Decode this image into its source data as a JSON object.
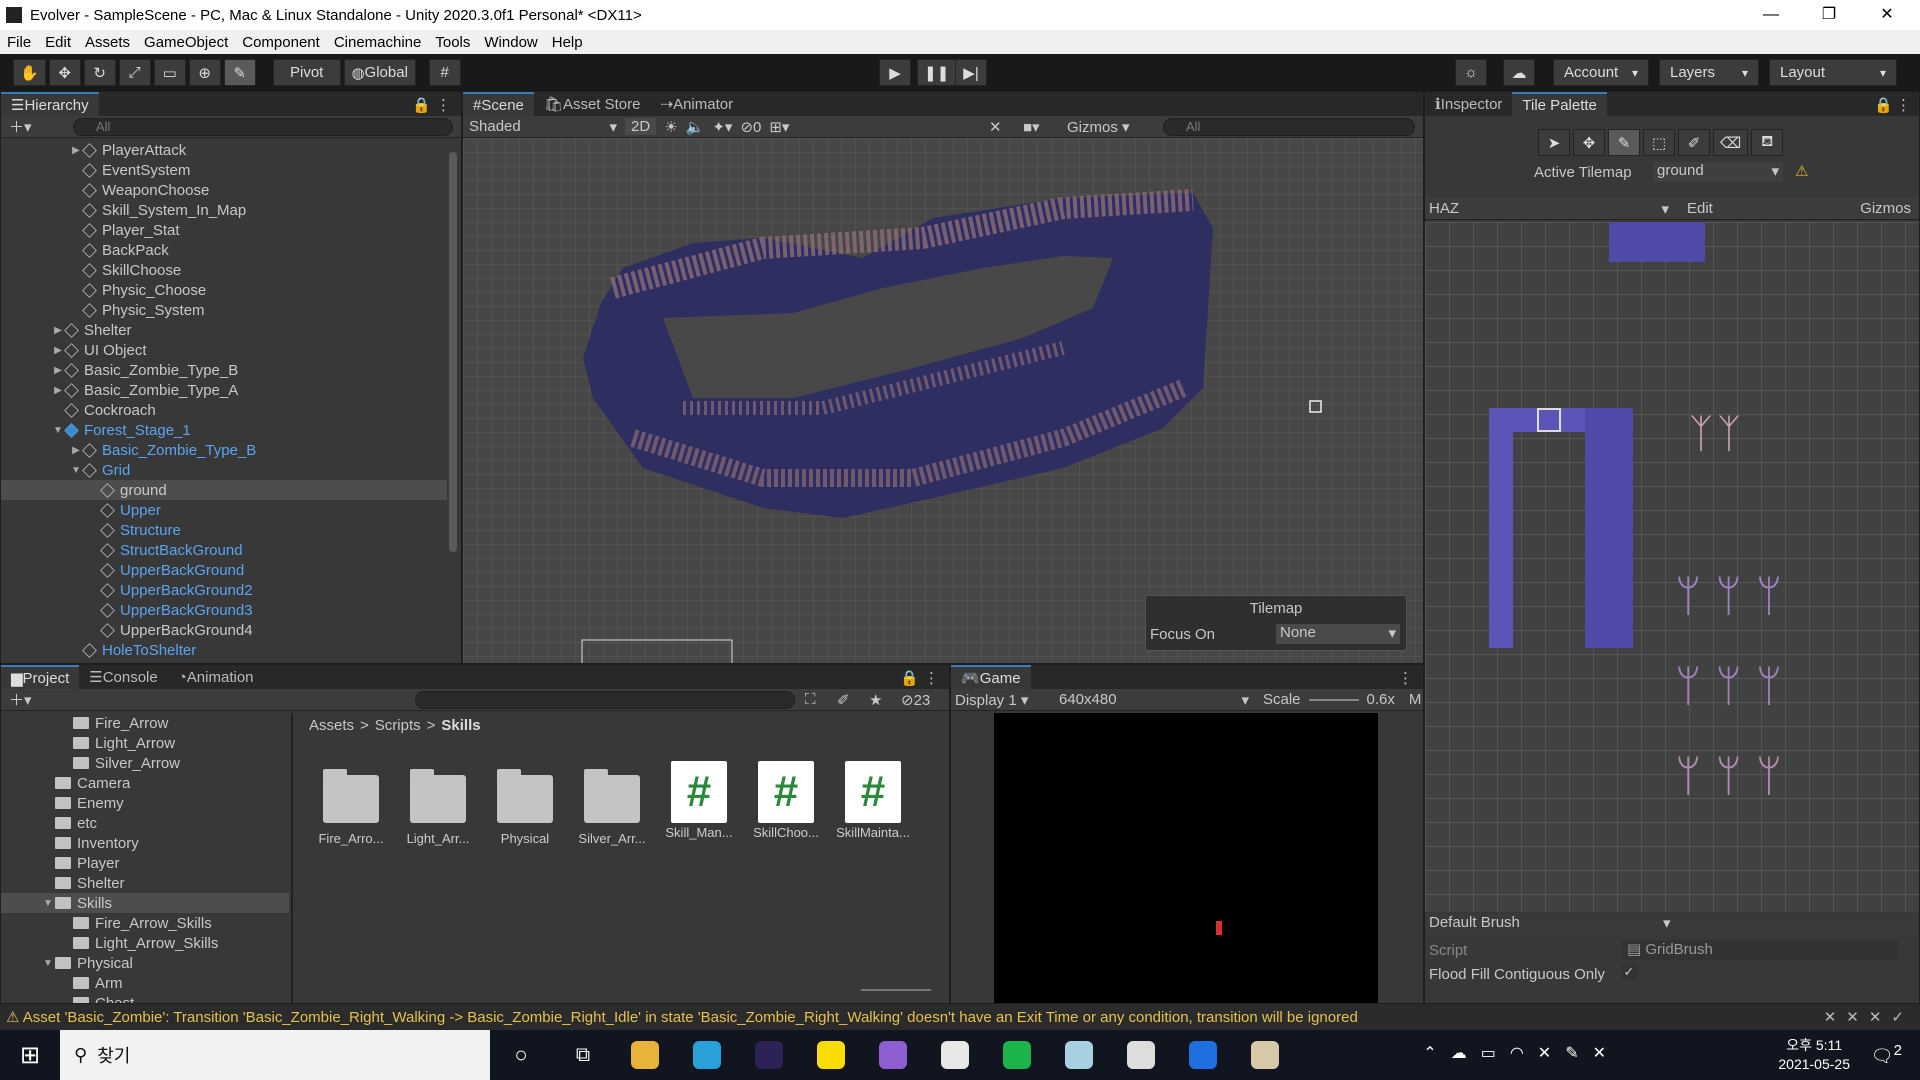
{
  "window": {
    "title": "Evolver - SampleScene - PC, Mac & Linux Standalone - Unity 2020.3.0f1 Personal* <DX11>",
    "min": "—",
    "max": "❐",
    "close": "✕"
  },
  "menu": [
    "File",
    "Edit",
    "Assets",
    "GameObject",
    "Component",
    "Cinemachine",
    "Tools",
    "Window",
    "Help"
  ],
  "toolbar": {
    "pivot": "Pivot",
    "global": "Global",
    "account": "Account",
    "layers": "Layers",
    "layout": "Layout"
  },
  "hierarchy": {
    "tab": "Hierarchy",
    "search_placeholder": "All",
    "rows": [
      {
        "label": "PlayerAttack",
        "depth": 2,
        "arrow": "▶",
        "blue": false
      },
      {
        "label": "EventSystem",
        "depth": 2,
        "arrow": "",
        "blue": false
      },
      {
        "label": "WeaponChoose",
        "depth": 2,
        "arrow": "",
        "blue": false
      },
      {
        "label": "Skill_System_In_Map",
        "depth": 2,
        "arrow": "",
        "blue": false
      },
      {
        "label": "Player_Stat",
        "depth": 2,
        "arrow": "",
        "blue": false
      },
      {
        "label": "BackPack",
        "depth": 2,
        "arrow": "",
        "blue": false
      },
      {
        "label": "SkillChoose",
        "depth": 2,
        "arrow": "",
        "blue": false
      },
      {
        "label": "Physic_Choose",
        "depth": 2,
        "arrow": "",
        "blue": false
      },
      {
        "label": "Physic_System",
        "depth": 2,
        "arrow": "",
        "blue": false
      },
      {
        "label": "Shelter",
        "depth": 1,
        "arrow": "▶",
        "blue": false
      },
      {
        "label": "UI Object",
        "depth": 1,
        "arrow": "▶",
        "blue": false
      },
      {
        "label": "Basic_Zombie_Type_B",
        "depth": 1,
        "arrow": "▶",
        "blue": false
      },
      {
        "label": "Basic_Zombie_Type_A",
        "depth": 1,
        "arrow": "▶",
        "blue": false
      },
      {
        "label": "Cockroach",
        "depth": 1,
        "arrow": "",
        "blue": false
      },
      {
        "label": "Forest_Stage_1",
        "depth": 1,
        "arrow": "▼",
        "blue": true
      },
      {
        "label": "Basic_Zombie_Type_B",
        "depth": 2,
        "arrow": "▶",
        "blue": true
      },
      {
        "label": "Grid",
        "depth": 2,
        "arrow": "▼",
        "blue": true
      },
      {
        "label": "ground",
        "depth": 3,
        "arrow": "",
        "blue": false,
        "selected": true
      },
      {
        "label": "Upper",
        "depth": 3,
        "arrow": "",
        "blue": true
      },
      {
        "label": "Structure",
        "depth": 3,
        "arrow": "",
        "blue": true
      },
      {
        "label": "StructBackGround",
        "depth": 3,
        "arrow": "",
        "blue": true
      },
      {
        "label": "UpperBackGround",
        "depth": 3,
        "arrow": "",
        "blue": true
      },
      {
        "label": "UpperBackGround2",
        "depth": 3,
        "arrow": "",
        "blue": true
      },
      {
        "label": "UpperBackGround3",
        "depth": 3,
        "arrow": "",
        "blue": true
      },
      {
        "label": "UpperBackGround4",
        "depth": 3,
        "arrow": "",
        "blue": false
      },
      {
        "label": "HoleToShelter",
        "depth": 2,
        "arrow": "",
        "blue": true
      }
    ]
  },
  "scene": {
    "tabs": [
      "Scene",
      "Asset Store",
      "Animator"
    ],
    "shading": "Shaded",
    "mode2d": "2D",
    "hidden_count": "0",
    "gizmos": "Gizmos",
    "search_placeholder": "All",
    "overlay": {
      "title": "Tilemap",
      "focus_label": "Focus On",
      "focus_value": "None"
    }
  },
  "inspector": {
    "tabs": [
      "Inspector",
      "Tile Palette"
    ],
    "active_tilemap_label": "Active Tilemap",
    "active_tilemap_value": "ground",
    "palette": "HAZ",
    "edit": "Edit",
    "gizmos": "Gizmos",
    "brush": "Default Brush",
    "script_label": "Script",
    "script_value": "GridBrush",
    "flood_label": "Flood Fill Contiguous Only",
    "flood_check": "✓"
  },
  "project": {
    "tabs": [
      "Project",
      "Console",
      "Animation"
    ],
    "hidden_count": "23",
    "tree": [
      {
        "label": "Fire_Arrow",
        "depth": 2,
        "arrow": ""
      },
      {
        "label": "Light_Arrow",
        "depth": 2,
        "arrow": ""
      },
      {
        "label": "Silver_Arrow",
        "depth": 2,
        "arrow": ""
      },
      {
        "label": "Camera",
        "depth": 1,
        "arrow": ""
      },
      {
        "label": "Enemy",
        "depth": 1,
        "arrow": ""
      },
      {
        "label": "etc",
        "depth": 1,
        "arrow": ""
      },
      {
        "label": "Inventory",
        "depth": 1,
        "arrow": ""
      },
      {
        "label": "Player",
        "depth": 1,
        "arrow": ""
      },
      {
        "label": "Shelter",
        "depth": 1,
        "arrow": ""
      },
      {
        "label": "Skills",
        "depth": 1,
        "arrow": "▼",
        "selected": true
      },
      {
        "label": "Fire_Arrow_Skills",
        "depth": 2,
        "arrow": ""
      },
      {
        "label": "Light_Arrow_Skills",
        "depth": 2,
        "arrow": ""
      },
      {
        "label": "Physical",
        "depth": 1,
        "arrow": "▼"
      },
      {
        "label": "Arm",
        "depth": 2,
        "arrow": ""
      },
      {
        "label": "Chest",
        "depth": 2,
        "arrow": ""
      }
    ],
    "breadcrumb": [
      "Assets",
      "Scripts",
      "Skills"
    ],
    "assets": [
      {
        "label": "Fire_Arro...",
        "type": "folder"
      },
      {
        "label": "Light_Arr...",
        "type": "folder"
      },
      {
        "label": "Physical",
        "type": "folder"
      },
      {
        "label": "Silver_Arr...",
        "type": "folder"
      },
      {
        "label": "Skill_Man...",
        "type": "script"
      },
      {
        "label": "SkillChoo...",
        "type": "script"
      },
      {
        "label": "SkillMainta...",
        "type": "script"
      }
    ]
  },
  "game": {
    "tab": "Game",
    "display": "Display 1",
    "resolution": "640x480",
    "scale_label": "Scale",
    "scale_value": "0.6x",
    "more": "M"
  },
  "status": "⚠ Asset 'Basic_Zombie': Transition 'Basic_Zombie_Right_Walking -> Basic_Zombie_Right_Idle' in state 'Basic_Zombie_Right_Walking' doesn't have an Exit Time or any condition, transition will be ignored",
  "taskbar": {
    "search": "찾기",
    "time": "오후 5:11",
    "date": "2021-05-25",
    "notif": "2",
    "apps": [
      {
        "name": "file-explorer-icon",
        "color": "#e8b339"
      },
      {
        "name": "edge-icon",
        "color": "#2aa0d8"
      },
      {
        "name": "eclipse-icon",
        "color": "#2c2255"
      },
      {
        "name": "kakaotalk-icon",
        "color": "#f8de00"
      },
      {
        "name": "visual-studio-icon",
        "color": "#8e5fd0"
      },
      {
        "name": "unity-hub-icon",
        "color": "#e8e8e8"
      },
      {
        "name": "green-app-icon",
        "color": "#1bb34a"
      },
      {
        "name": "notes-icon",
        "color": "#a8d0e0"
      },
      {
        "name": "unity-icon",
        "color": "#dddddd"
      },
      {
        "name": "maps-icon",
        "color": "#1f6fe0"
      },
      {
        "name": "paint-icon",
        "color": "#d7c9a8"
      }
    ]
  }
}
